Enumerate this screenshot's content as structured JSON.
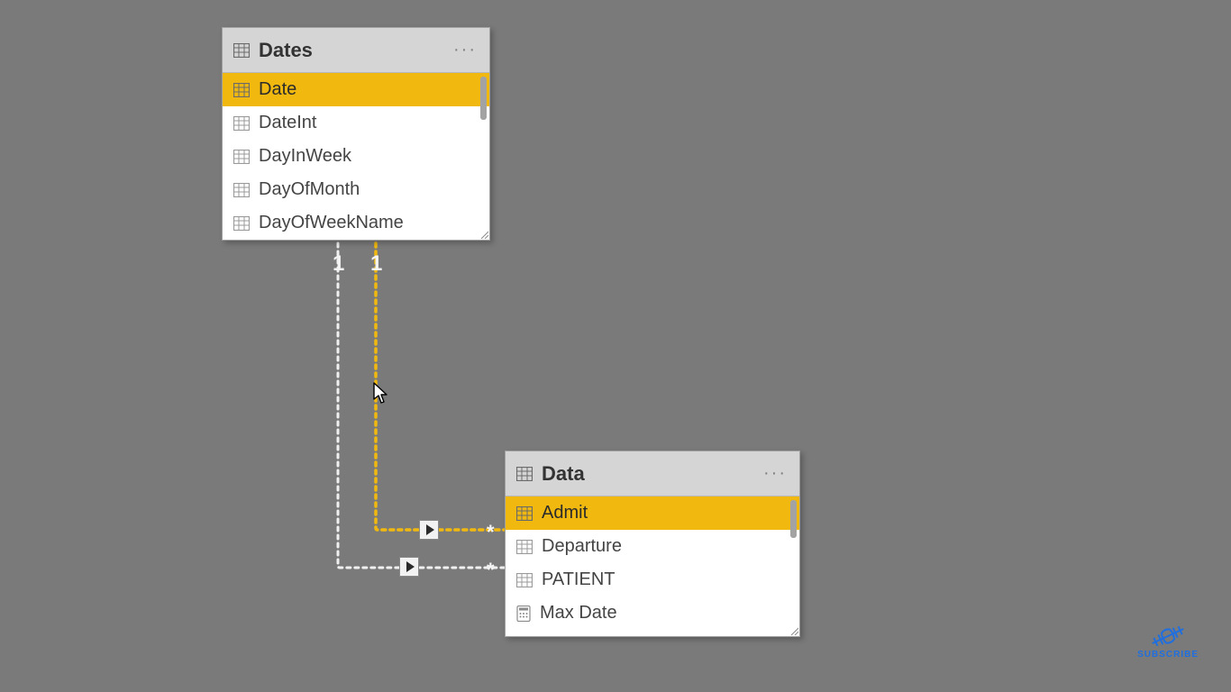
{
  "tables": {
    "dates": {
      "title": "Dates",
      "fields": [
        {
          "label": "Date",
          "icon": "table",
          "selected": true
        },
        {
          "label": "DateInt",
          "icon": "table",
          "selected": false
        },
        {
          "label": "DayInWeek",
          "icon": "table",
          "selected": false
        },
        {
          "label": "DayOfMonth",
          "icon": "table",
          "selected": false
        },
        {
          "label": "DayOfWeekName",
          "icon": "table",
          "selected": false
        }
      ]
    },
    "data": {
      "title": "Data",
      "fields": [
        {
          "label": "Admit",
          "icon": "table",
          "selected": true
        },
        {
          "label": "Departure",
          "icon": "table",
          "selected": false
        },
        {
          "label": "PATIENT",
          "icon": "table",
          "selected": false
        },
        {
          "label": "Max Date",
          "icon": "calc",
          "selected": false
        }
      ]
    }
  },
  "relationships": {
    "rel1": {
      "from_card": "1",
      "to_card": "*",
      "active": false
    },
    "rel2": {
      "from_card": "1",
      "to_card": "*",
      "active": true
    }
  },
  "watermark": {
    "label": "SUBSCRIBE"
  }
}
